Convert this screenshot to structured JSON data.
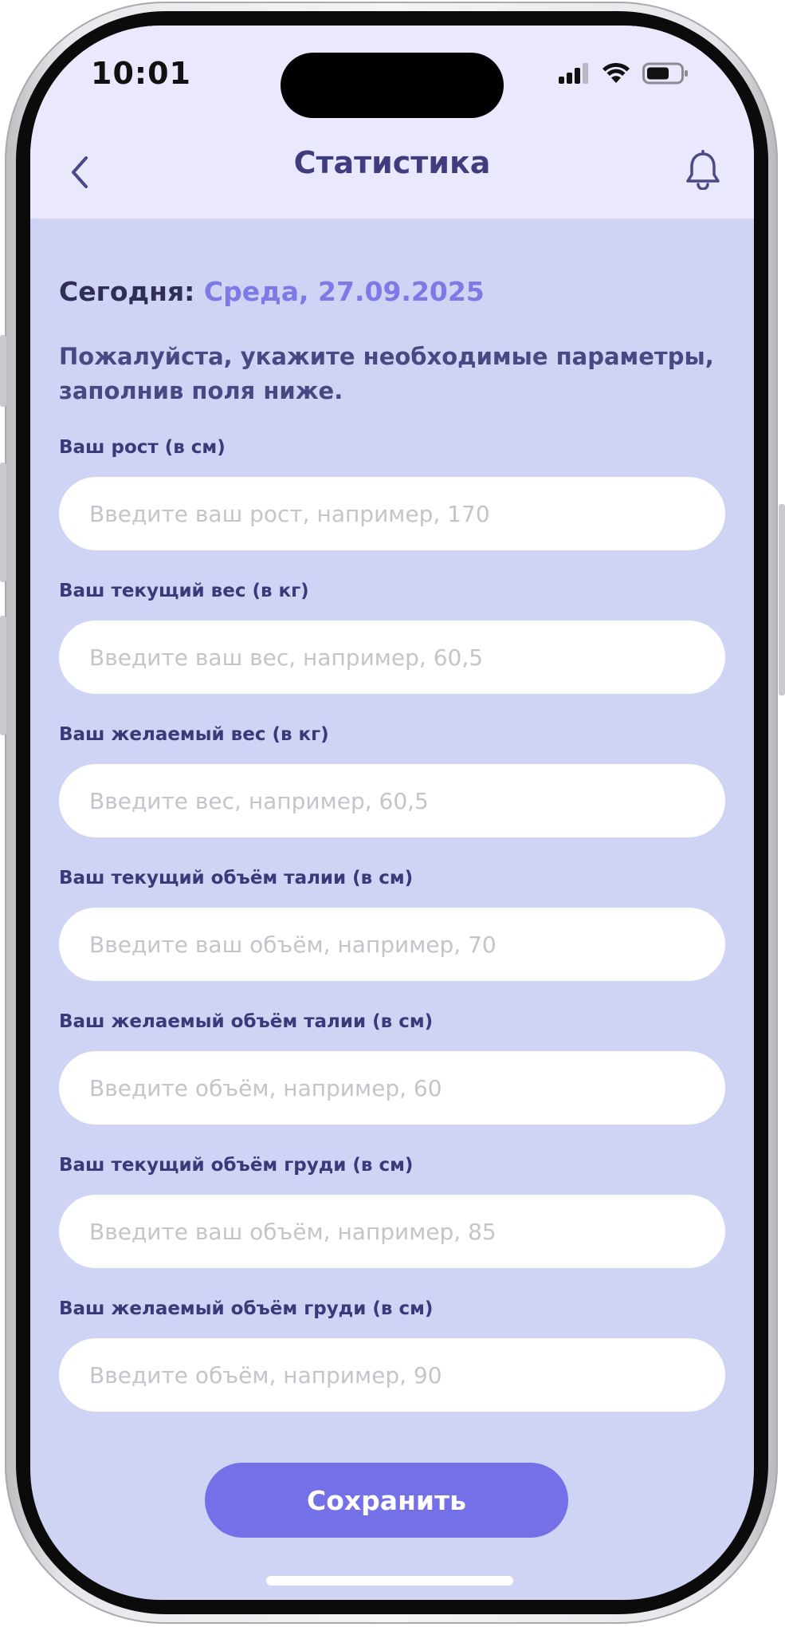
{
  "status_bar": {
    "time": "10:01"
  },
  "nav": {
    "title": "Статистика",
    "back_icon": "chevron-left-icon",
    "bell_icon": "bell-icon"
  },
  "today": {
    "label": "Сегодня:",
    "date": "Среда, 27.09.2025"
  },
  "intro": "Пожалуйста, укажите необходимые параметры, заполнив поля ниже.",
  "fields": [
    {
      "label": "Ваш рост (в см)",
      "placeholder": "Введите ваш рост, например, 170",
      "value": ""
    },
    {
      "label": "Ваш текущий вес (в кг)",
      "placeholder": "Введите ваш вес, например, 60,5",
      "value": ""
    },
    {
      "label": "Ваш желаемый вес (в кг)",
      "placeholder": "Введите вес, например, 60,5",
      "value": ""
    },
    {
      "label": "Ваш текущий объём талии (в см)",
      "placeholder": "Введите ваш объём, например, 70",
      "value": ""
    },
    {
      "label": "Ваш желаемый объём талии (в см)",
      "placeholder": "Введите объём, например, 60",
      "value": ""
    },
    {
      "label": "Ваш текущий объём груди (в см)",
      "placeholder": "Введите ваш объём, например, 85",
      "value": ""
    },
    {
      "label": "Ваш желаемый объём груди (в см)",
      "placeholder": "Введите объём, например, 90",
      "value": ""
    }
  ],
  "save_button": "Сохранить",
  "colors": {
    "header_bg": "#e9e8fd",
    "content_bg": "#cfd4f4",
    "title": "#3f3d7e",
    "accent": "#7470e8",
    "date_accent": "#7d79e6"
  }
}
